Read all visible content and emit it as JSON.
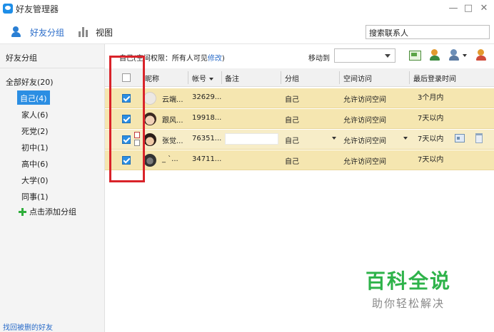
{
  "window": {
    "title": "好友管理器",
    "controls": {
      "minimize": "—",
      "maximize": "□",
      "close": "✕"
    }
  },
  "toolbar": {
    "group_label": "好友分组",
    "view_label": "视图",
    "search_value": "搜索联系人"
  },
  "sidebar": {
    "header": "好友分组",
    "all_friends": "全部好友(20)",
    "groups": [
      {
        "label": "自己(4)",
        "active": true
      },
      {
        "label": "家人(6)",
        "active": false
      },
      {
        "label": "死党(2)",
        "active": false
      },
      {
        "label": "初中(1)",
        "active": false
      },
      {
        "label": "高中(6)",
        "active": false
      },
      {
        "label": "大学(0)",
        "active": false
      },
      {
        "label": "同事(1)",
        "active": false
      }
    ],
    "add_group": "点击添加分组",
    "recover_deleted": "找回被删的好友"
  },
  "infobar": {
    "permission_prefix": "自己(空间权限：所有人可见",
    "permission_link": "修改",
    "permission_suffix": ")",
    "move_to_label": "移动到",
    "move_to_value": ""
  },
  "table": {
    "columns": [
      "昵称",
      "帐号",
      "备注",
      "分组",
      "空间访问",
      "最后登录时间"
    ],
    "rows": [
      {
        "name": "云端...",
        "account": "32629...",
        "remark": "",
        "group": "自己",
        "space": "允许访问空间",
        "last_login": "3个月内",
        "selected": true
      },
      {
        "name": "跟风...",
        "account": "19918...",
        "remark": "",
        "group": "自己",
        "space": "允许访问空间",
        "last_login": "7天以内",
        "selected": true
      },
      {
        "name": "张觉...",
        "account": "76351...",
        "remark": "",
        "group": "自己",
        "space": "允许访问空间",
        "last_login": "7天以内",
        "selected": true
      },
      {
        "name": "_ `...",
        "account": "34711...",
        "remark": "",
        "group": "自己",
        "space": "允许访问空间",
        "last_login": "7天以内",
        "selected": true
      }
    ]
  },
  "watermark": {
    "title": "百科全说",
    "subtitle": "助你轻松解决"
  },
  "colors": {
    "accent": "#2b8ee3",
    "row_selected": "#f5e6b0",
    "highlight_box": "#d9232a",
    "watermark_green": "#2eb34a"
  }
}
